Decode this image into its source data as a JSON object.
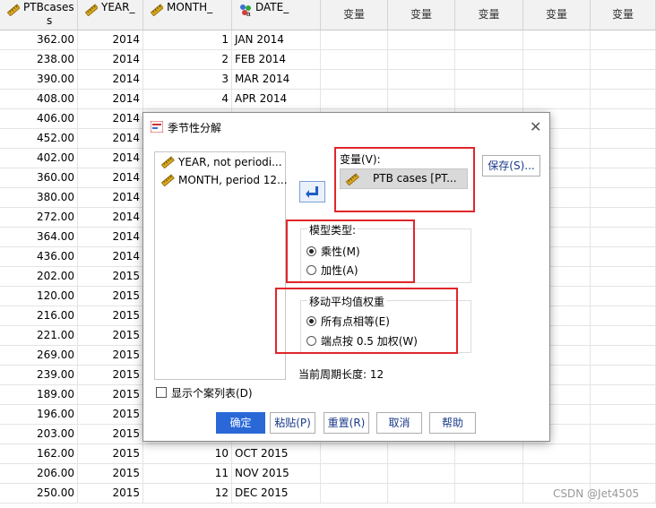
{
  "columns": [
    {
      "label": "PTBcases",
      "type": "scale"
    },
    {
      "label": "YEAR_",
      "type": "scale"
    },
    {
      "label": "MONTH_",
      "type": "scale"
    },
    {
      "label": "DATE_",
      "type": "nominal"
    },
    {
      "label": "变量"
    },
    {
      "label": "变量"
    },
    {
      "label": "变量"
    },
    {
      "label": "变量"
    },
    {
      "label": "变量"
    }
  ],
  "rows": [
    [
      "362.00",
      "2014",
      "1",
      "JAN 2014"
    ],
    [
      "238.00",
      "2014",
      "2",
      "FEB 2014"
    ],
    [
      "390.00",
      "2014",
      "3",
      "MAR 2014"
    ],
    [
      "408.00",
      "2014",
      "4",
      "APR 2014"
    ],
    [
      "406.00",
      "2014",
      "",
      ""
    ],
    [
      "452.00",
      "2014",
      "",
      ""
    ],
    [
      "402.00",
      "2014",
      "",
      ""
    ],
    [
      "360.00",
      "2014",
      "",
      ""
    ],
    [
      "380.00",
      "2014",
      "",
      ""
    ],
    [
      "272.00",
      "2014",
      "",
      ""
    ],
    [
      "364.00",
      "2014",
      "",
      ""
    ],
    [
      "436.00",
      "2014",
      "",
      ""
    ],
    [
      "202.00",
      "2015",
      "",
      ""
    ],
    [
      "120.00",
      "2015",
      "",
      ""
    ],
    [
      "216.00",
      "2015",
      "",
      ""
    ],
    [
      "221.00",
      "2015",
      "",
      ""
    ],
    [
      "269.00",
      "2015",
      "",
      ""
    ],
    [
      "239.00",
      "2015",
      "",
      ""
    ],
    [
      "189.00",
      "2015",
      "",
      ""
    ],
    [
      "196.00",
      "2015",
      "",
      ""
    ],
    [
      "203.00",
      "2015",
      "",
      ""
    ],
    [
      "162.00",
      "2015",
      "10",
      "OCT 2015"
    ],
    [
      "206.00",
      "2015",
      "11",
      "NOV 2015"
    ],
    [
      "250.00",
      "2015",
      "12",
      "DEC 2015"
    ]
  ],
  "dialog": {
    "title": "季节性分解",
    "source_vars": [
      "YEAR, not periodi...",
      "MONTH, period 12..."
    ],
    "variables_label": "变量(V):",
    "selected_var": "PTB cases [PT...",
    "save_button": "保存(S)...",
    "model_group": "模型类型:",
    "model_options": [
      "乘性(M)",
      "加性(A)"
    ],
    "model_selected": 0,
    "ma_group": "移动平均值权重",
    "ma_options": [
      "所有点相等(E)",
      "端点按 0.5 加权(W)"
    ],
    "ma_selected": 0,
    "period_text": "当前周期长度: 12",
    "casewise_label": "显示个案列表(D)",
    "casewise_checked": false,
    "buttons": {
      "ok": "确定",
      "paste": "粘贴(P)",
      "reset": "重置(R)",
      "cancel": "取消",
      "help": "帮助"
    }
  },
  "watermark": "CSDN @Jet4505",
  "colors": {
    "highlight": "#e0262b",
    "primary": "#2a68d8",
    "ruler": "#d8a51c"
  }
}
